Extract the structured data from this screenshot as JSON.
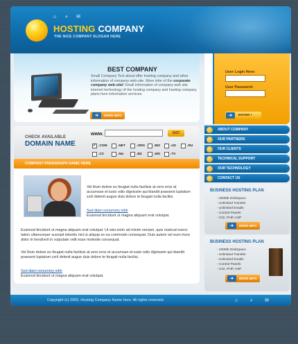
{
  "header": {
    "brand_part1": "HOSTING",
    "brand_part2": "COMPANY",
    "slogan": "THE NICE COMPANY SLOGAN HERE",
    "icons": [
      "home-icon",
      "search-icon",
      "mail-icon"
    ]
  },
  "hero": {
    "title": "BEST COMPANY",
    "text_intro": "Small Company Text about offer hosting company and other information of company web-site. More infor of the ",
    "text_bold": "corporate company web-site!",
    "text_rest": " Small information of company web site internet technology of the hosting company and hosting company plans here information services.",
    "more_label": "MORE INFO"
  },
  "domain": {
    "check_label": "CHECK AVAILABLE",
    "domain_label": "DOMAIN NAME",
    "www_label": "www.",
    "input_value": "",
    "go_label": "GO!",
    "tlds": [
      {
        "label": ".COM",
        "checked": true
      },
      {
        "label": ".NET",
        "checked": false
      },
      {
        "label": ".ORG",
        "checked": false
      },
      {
        "label": ".BIZ",
        "checked": false
      },
      {
        "label": ".US",
        "checked": false
      },
      {
        "label": ".RU",
        "checked": false
      },
      {
        "label": ".CC",
        "checked": false
      },
      {
        "label": ".NU",
        "checked": false
      },
      {
        "label": ".BZ",
        "checked": false
      },
      {
        "label": ".WS",
        "checked": false
      },
      {
        "label": ".TV",
        "checked": false
      }
    ]
  },
  "paragraph": {
    "bar_title": "COMPANY PARAGRAPH NAME HERE",
    "p1": "Vel illum dolore eu feugiat nulla facilisis at vero eros at accumsan et iusto odio dignissim qui blandit praesent luptatum zzril delenit augue duis dolore te feugait nulla facilisi.",
    "link1": "Sed diam nonummy nibh",
    "p1b": "Euismod tincidunt ut magna aliquam erat volutpat.",
    "p2": "Euismod tincidunt ut magna aliquam erat volutpat. Ut wisi enim ad minim veniam, quis nostrud exerci tation ullamcorper suscipit lobortis nisl ut aliquip ex ea commodo consequat. Duis autem vel eum iriure dolor in hendrerit in vulputate velit esse molestie consequat.",
    "p3": "Vel illum dolore eu feugiat nulla facilisis at vero eros et accumsan et iusto odio dignissim qui blandit praesent luptatum zzril delenit augue duis dolore te feugait nulla facilisi.",
    "link2": "Sed diam nonummy nibh",
    "p3b": "Euismod tincidunt ut magna aliquam erat volutpat."
  },
  "login": {
    "login_label": "User Login Here:",
    "login_value": "",
    "password_label": "User Password:",
    "password_value": "",
    "enter_label": "ENTER !"
  },
  "menu": {
    "items": [
      "ABOUT COMPANY",
      "OUR PARTNERS",
      "OUR CLIENTS",
      "TECHNICAL SUPPORT",
      "OUR TECHNOLOGY",
      "CONTACT US"
    ]
  },
  "plans": [
    {
      "title": "BUSINESS HOSTING PLAN",
      "features": [
        "- 200Mb DiskSpace",
        "- Unlimited Transfer",
        "- Unlimited Emails",
        "- Control Panels",
        "- CGI, PHP, ASP"
      ],
      "more_label": "MORE INFO"
    },
    {
      "title": "BUSINESS HOSTING PLAN",
      "features": [
        "- 200Mb DiskSpace",
        "- Unlimited Transfer",
        "- Unlimited Emails",
        "- Control Panels",
        "- CGI, PHP, ASP"
      ],
      "more_label": "MORE INFO"
    }
  ],
  "footer": {
    "copyright": "Copyright (c) 2003. Hosting Company Name here. All rights reserved.",
    "icons": [
      "home-icon",
      "search-icon",
      "mail-icon"
    ]
  }
}
